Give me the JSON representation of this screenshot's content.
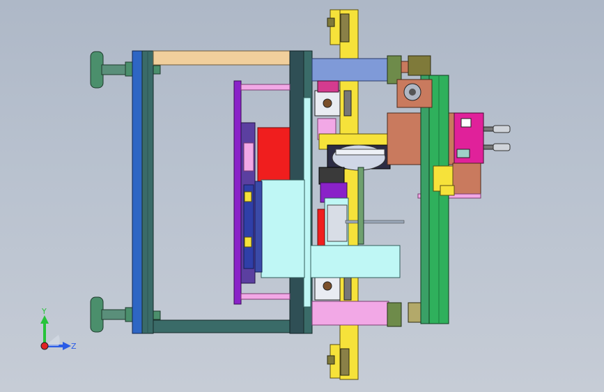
{
  "viewport": {
    "background_top": "#aeb8c7",
    "background_bottom": "#c6ccd6"
  },
  "triad": {
    "y_label": "Y",
    "z_label": "Z",
    "y_color": "#27c33a",
    "z_color": "#2b5ce6",
    "x_color": "#e02424"
  },
  "palette": {
    "frame_blue": "#2e66c4",
    "frame_teal": "#3a6b68",
    "frame_dark": "#2f4f55",
    "beam_tan": "#f1cf9c",
    "rail_yellow": "#f6e23a",
    "cyan_plate": "#bff7f5",
    "purple": "#8a22c8",
    "pink": "#f2a8e6",
    "red": "#f01e1e",
    "salmon": "#c97a5e",
    "magenta": "#e0219a",
    "green_rail": "#2fb05c",
    "olive": "#7f7a3a",
    "cornflower": "#7f9ad8"
  },
  "model_parts": [
    "leveling-foot-top",
    "leveling-foot-bottom",
    "frame-left-plate",
    "frame-left-column",
    "top-beam",
    "bottom-beam",
    "center-column",
    "purple-plate",
    "red-block",
    "cyan-block",
    "yellow-rail",
    "slide-unit",
    "motor-box",
    "control-box",
    "green-linear-rail",
    "pink-block"
  ]
}
